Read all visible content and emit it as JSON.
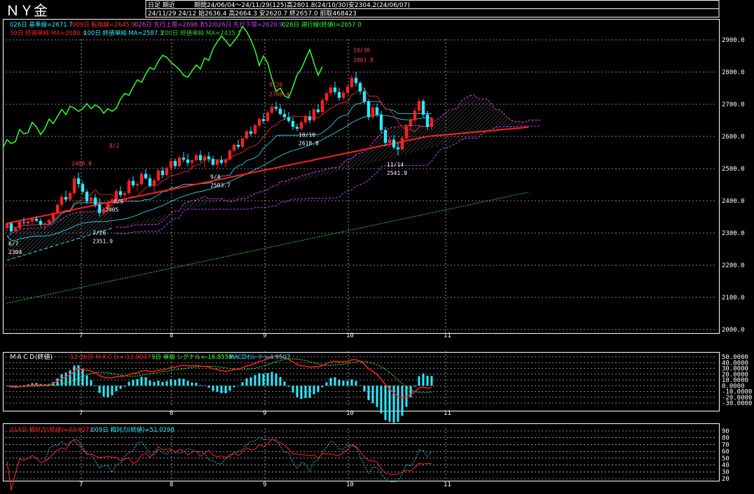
{
  "header": {
    "title": "ＮＹ金",
    "mode": "日足 期近",
    "period": "期間24/06/04～24/11/29(125)高2801.8(24/10/30)安2304.2(24/06/07)",
    "ohlc": "24/11/29 24/12 始2636.4 高2664.3 安2620.7 終2657.0 前取468423"
  },
  "colors": {
    "up": "#ff2020",
    "down": "#30e8ff",
    "kijun": "#30e8ff",
    "tenkan": "#ff3030",
    "senkouA": "#e040e0",
    "senkouB": "#c040ff",
    "chikou": "#30ff30",
    "ma50": "#ff2020",
    "ma100": "#30e8ff",
    "ma200": "#30cc30",
    "grid": "#ffffff"
  },
  "legend": {
    "row1": [
      {
        "text": "026日 基準線=2671.7",
        "color": "#30e8ff"
      },
      {
        "text": "009日 転換線=2645.9",
        "color": "#ff3030"
      },
      {
        "text": "026日 先行上限=2698.7",
        "color": "#e040e0"
      },
      {
        "text": "052/026日 先行下限=2620.9",
        "color": "#c040ff"
      },
      {
        "text": "026日 遅行線(終値)=2657.0",
        "color": "#30ff30"
      }
    ],
    "row2": [
      {
        "text": "50日 終値単純 MA=2680.4",
        "color": "#ff2020"
      },
      {
        "text": "100日 終値単純 MA=2587.3",
        "color": "#30e8ff"
      },
      {
        "text": "200日 終値単純 MA=2435.1",
        "color": "#30cc30"
      }
    ]
  },
  "chart_data": [
    {
      "type": "candlestick",
      "y_ticks": [
        "2900.0",
        "2800.0",
        "2700.0",
        "2600.0",
        "2500.0",
        "2400.0",
        "2300.0",
        "2200.0",
        "2100.0",
        "2000.0"
      ],
      "ylim": [
        2000,
        2960
      ],
      "month_labels": [
        "7",
        "8",
        "9",
        "10",
        "11"
      ],
      "month_positions": [
        116,
        245,
        378,
        497,
        636
      ],
      "n_days": 125,
      "candles": [
        [
          2316,
          2333,
          2304,
          2330
        ],
        [
          2330,
          2335,
          2300,
          2305
        ],
        [
          2306,
          2316,
          2304,
          2315
        ],
        [
          2314,
          2338,
          2312,
          2335
        ],
        [
          2334,
          2348,
          2326,
          2332
        ],
        [
          2330,
          2340,
          2320,
          2336
        ],
        [
          2336,
          2350,
          2328,
          2344
        ],
        [
          2344,
          2352,
          2334,
          2338
        ],
        [
          2338,
          2346,
          2320,
          2326
        ],
        [
          2326,
          2334,
          2310,
          2330
        ],
        [
          2330,
          2345,
          2325,
          2340
        ],
        [
          2340,
          2368,
          2336,
          2362
        ],
        [
          2362,
          2392,
          2356,
          2388
        ],
        [
          2388,
          2420,
          2380,
          2412
        ],
        [
          2412,
          2432,
          2396,
          2404
        ],
        [
          2404,
          2430,
          2398,
          2424
        ],
        [
          2424,
          2478,
          2418,
          2470
        ],
        [
          2470,
          2488,
          2440,
          2452
        ],
        [
          2452,
          2462,
          2420,
          2428
        ],
        [
          2428,
          2436,
          2390,
          2398
        ],
        [
          2398,
          2418,
          2388,
          2410
        ],
        [
          2410,
          2420,
          2380,
          2388
        ],
        [
          2388,
          2408,
          2351,
          2362
        ],
        [
          2362,
          2380,
          2354,
          2374
        ],
        [
          2374,
          2398,
          2366,
          2392
        ],
        [
          2392,
          2410,
          2384,
          2404
        ],
        [
          2404,
          2436,
          2398,
          2430
        ],
        [
          2430,
          2446,
          2410,
          2418
        ],
        [
          2418,
          2430,
          2400,
          2424
        ],
        [
          2424,
          2470,
          2418,
          2462
        ],
        [
          2462,
          2476,
          2440,
          2448
        ],
        [
          2448,
          2460,
          2430,
          2452
        ],
        [
          2452,
          2490,
          2446,
          2484
        ],
        [
          2484,
          2498,
          2466,
          2470
        ],
        [
          2470,
          2482,
          2440,
          2446
        ],
        [
          2446,
          2470,
          2428,
          2464
        ],
        [
          2464,
          2500,
          2456,
          2494
        ],
        [
          2494,
          2506,
          2470,
          2480
        ],
        [
          2480,
          2508,
          2474,
          2502
        ],
        [
          2502,
          2530,
          2496,
          2524
        ],
        [
          2524,
          2532,
          2500,
          2508
        ],
        [
          2508,
          2540,
          2502,
          2534
        ],
        [
          2534,
          2552,
          2520,
          2528
        ],
        [
          2528,
          2546,
          2508,
          2518
        ],
        [
          2518,
          2530,
          2500,
          2526
        ],
        [
          2526,
          2548,
          2520,
          2542
        ],
        [
          2542,
          2556,
          2520,
          2526
        ],
        [
          2526,
          2544,
          2504,
          2538
        ],
        [
          2538,
          2552,
          2520,
          2530
        ],
        [
          2530,
          2540,
          2508,
          2512
        ],
        [
          2512,
          2530,
          2503,
          2526
        ],
        [
          2526,
          2540,
          2512,
          2518
        ],
        [
          2518,
          2532,
          2504,
          2528
        ],
        [
          2528,
          2560,
          2524,
          2556
        ],
        [
          2556,
          2580,
          2550,
          2574
        ],
        [
          2574,
          2590,
          2560,
          2568
        ],
        [
          2568,
          2598,
          2562,
          2594
        ],
        [
          2594,
          2622,
          2588,
          2616
        ],
        [
          2616,
          2630,
          2600,
          2608
        ],
        [
          2608,
          2640,
          2604,
          2634
        ],
        [
          2634,
          2660,
          2628,
          2654
        ],
        [
          2654,
          2672,
          2640,
          2648
        ],
        [
          2648,
          2680,
          2644,
          2674
        ],
        [
          2674,
          2700,
          2668,
          2692
        ],
        [
          2692,
          2708,
          2678,
          2686
        ],
        [
          2686,
          2700,
          2664,
          2670
        ],
        [
          2670,
          2684,
          2650,
          2660
        ],
        [
          2660,
          2676,
          2642,
          2648
        ],
        [
          2648,
          2660,
          2620,
          2630
        ],
        [
          2630,
          2640,
          2616,
          2624
        ],
        [
          2624,
          2650,
          2618,
          2644
        ],
        [
          2644,
          2670,
          2636,
          2662
        ],
        [
          2662,
          2680,
          2640,
          2650
        ],
        [
          2650,
          2690,
          2644,
          2684
        ],
        [
          2684,
          2700,
          2670,
          2676
        ],
        [
          2676,
          2720,
          2670,
          2712
        ],
        [
          2712,
          2740,
          2700,
          2734
        ],
        [
          2734,
          2760,
          2724,
          2752
        ],
        [
          2752,
          2770,
          2730,
          2738
        ],
        [
          2738,
          2752,
          2712,
          2720
        ],
        [
          2720,
          2744,
          2712,
          2736
        ],
        [
          2736,
          2760,
          2730,
          2754
        ],
        [
          2754,
          2790,
          2748,
          2782
        ],
        [
          2782,
          2801,
          2756,
          2766
        ],
        [
          2766,
          2772,
          2730,
          2740
        ],
        [
          2740,
          2750,
          2700,
          2708
        ],
        [
          2708,
          2716,
          2650,
          2660
        ],
        [
          2660,
          2700,
          2654,
          2690
        ],
        [
          2690,
          2702,
          2660,
          2668
        ],
        [
          2668,
          2680,
          2610,
          2620
        ],
        [
          2620,
          2630,
          2570,
          2580
        ],
        [
          2580,
          2600,
          2566,
          2590
        ],
        [
          2590,
          2604,
          2560,
          2566
        ],
        [
          2566,
          2580,
          2541,
          2560
        ],
        [
          2560,
          2600,
          2556,
          2594
        ],
        [
          2594,
          2640,
          2590,
          2632
        ],
        [
          2632,
          2660,
          2620,
          2650
        ],
        [
          2650,
          2690,
          2640,
          2680
        ],
        [
          2680,
          2720,
          2670,
          2710
        ],
        [
          2710,
          2716,
          2660,
          2668
        ],
        [
          2668,
          2680,
          2620,
          2630
        ],
        [
          2630,
          2660,
          2620,
          2657
        ]
      ],
      "annotations": [
        {
          "text": "6/7",
          "day": 2,
          "price": 2304,
          "dy": 20,
          "color": "#ffffff"
        },
        {
          "text": "2304",
          "day": 2,
          "price": 2304,
          "dy": 32,
          "color": "#ffffff"
        },
        {
          "text": "2488.8",
          "day": 17,
          "price": 2488,
          "dy": -10,
          "color": "#ff4040"
        },
        {
          "text": "7/26",
          "day": 22,
          "price": 2351,
          "dy": 26,
          "color": "#ffffff"
        },
        {
          "text": "2351.9",
          "day": 22,
          "price": 2351,
          "dy": 38,
          "color": "#ffffff"
        },
        {
          "text": "8/2",
          "day": 26,
          "price": 2478,
          "dy": -40,
          "color": "#ff4040"
        },
        {
          "text": "8/5",
          "day": 27,
          "price": 2410,
          "dy": 8,
          "color": "#ffffff"
        },
        {
          "text": "2405",
          "day": 25,
          "price": 2410,
          "dy": 20,
          "color": "#ffffff"
        },
        {
          "text": "9/4",
          "day": 50,
          "price": 2503,
          "dy": 16,
          "color": "#ffffff"
        },
        {
          "text": "2503.7",
          "day": 50,
          "price": 2503,
          "dy": 28,
          "color": "#ffffff"
        },
        {
          "text": "9/26",
          "day": 64,
          "price": 2708,
          "dy": -22,
          "color": "#ff4040"
        },
        {
          "text": "2708.4",
          "day": 64,
          "price": 2708,
          "dy": -8,
          "color": "#ff4040"
        },
        {
          "text": "10/10",
          "day": 71,
          "price": 2616,
          "dy": 8,
          "color": "#ffffff"
        },
        {
          "text": "2618.8",
          "day": 71,
          "price": 2616,
          "dy": 20,
          "color": "#ffffff"
        },
        {
          "text": "10/30",
          "day": 84,
          "price": 2801,
          "dy": -28,
          "color": "#ff4040"
        },
        {
          "text": "2801.8",
          "day": 84,
          "price": 2801,
          "dy": -14,
          "color": "#ff4040"
        },
        {
          "text": "11/14",
          "day": 92,
          "price": 2541,
          "dy": 16,
          "color": "#ffffff"
        },
        {
          "text": "2541.9",
          "day": 92,
          "price": 2541,
          "dy": 28,
          "color": "#ffffff"
        }
      ]
    },
    {
      "type": "line",
      "title": "ＭＡＣＤ(終値)",
      "legend": [
        {
          "text": "12-26日 ＭＡＣＤ=-11.9047",
          "color": "#ff2020"
        },
        {
          "text": "9日 単純 シグナル=-16.8554",
          "color": "#30ff30"
        },
        {
          "text": "MACDｵｼﾚｰﾀｰ=4.9507",
          "color": "#30e8ff"
        }
      ],
      "y_ticks": [
        "50.0000",
        "40.0000",
        "30.0000",
        "20.0000",
        "10.0000",
        "0.0000",
        "-10.0000",
        "-20.0000",
        "-30.0000"
      ],
      "ylim": [
        -32,
        50
      ]
    },
    {
      "type": "line",
      "legend": [
        {
          "text": "014日 相対力(終値)=49.6271",
          "color": "#ff2020"
        },
        {
          "text": "009日 相対力(終値)=51.0298",
          "color": "#30e8ff"
        }
      ],
      "y_ticks": [
        "90",
        "80",
        "70",
        "60",
        "50",
        "40",
        "30",
        "20"
      ],
      "ylim": [
        18,
        92
      ]
    }
  ]
}
